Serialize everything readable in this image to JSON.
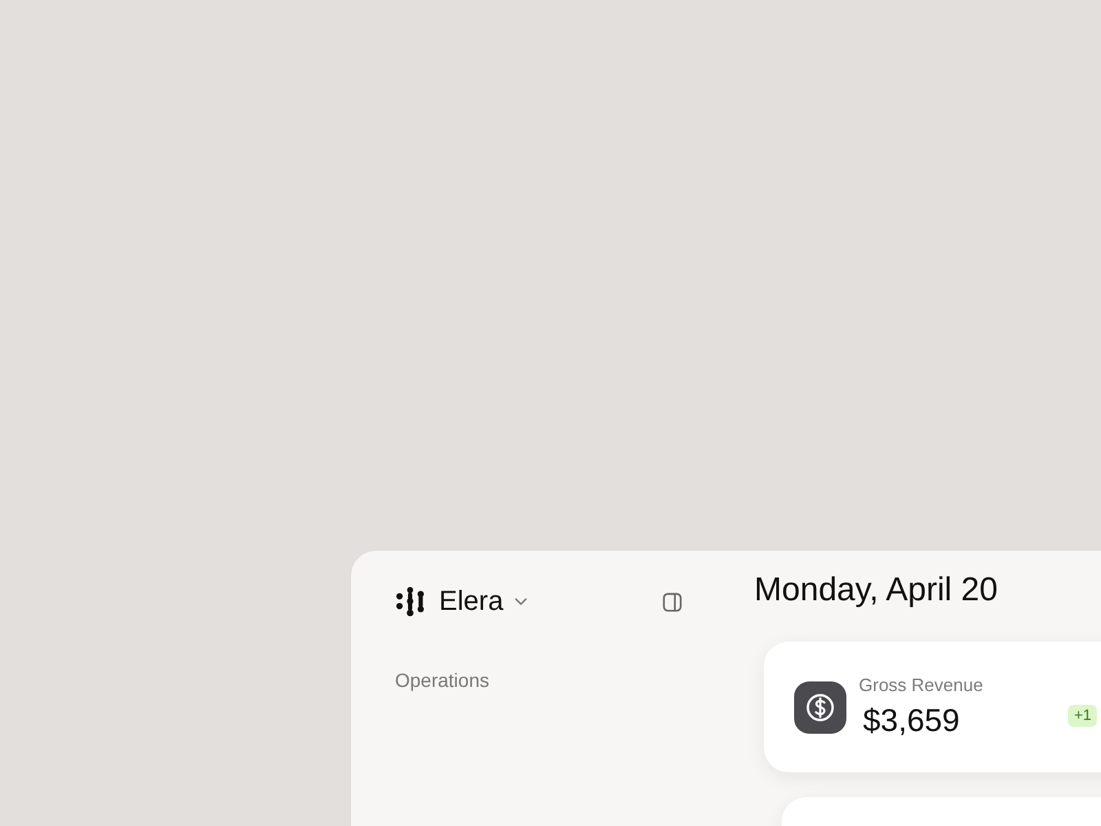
{
  "sidebar": {
    "brand": "Elera",
    "section_label": "Operations"
  },
  "main": {
    "title": "Monday, April 20",
    "stats": [
      {
        "label": "Gross Revenue",
        "value": "$3,659",
        "change": "+1"
      }
    ]
  }
}
